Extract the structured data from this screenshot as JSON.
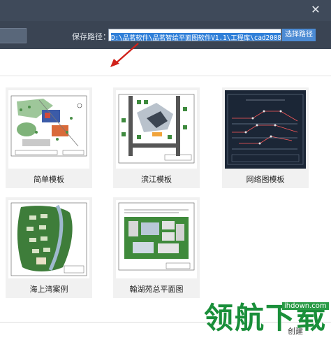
{
  "window": {
    "close_glyph": "✕"
  },
  "toolbar": {
    "path_label": "保存路径：",
    "path_value": "D:\\品茗软件\\品茗智绘平面图软件V1.1\\工程库\\cad2008",
    "choose_button": "选择路径"
  },
  "templates": [
    {
      "label": "简单模板"
    },
    {
      "label": "滨江模板"
    },
    {
      "label": "网络图模板"
    },
    {
      "label": "海上湾案例"
    },
    {
      "label": "翰湖苑总平面图"
    }
  ],
  "footer": {
    "create_button": "创建"
  },
  "watermark": {
    "brand": "领航下载",
    "url": "ihdown.com"
  },
  "colors": {
    "titlebar": "#3f4a5a",
    "toolbar": "#3a4453",
    "selection": "#2f7fd8",
    "accent_button": "#4c8bd4",
    "annotation_arrow": "#d0221b",
    "watermark": "#1a8f3a"
  }
}
